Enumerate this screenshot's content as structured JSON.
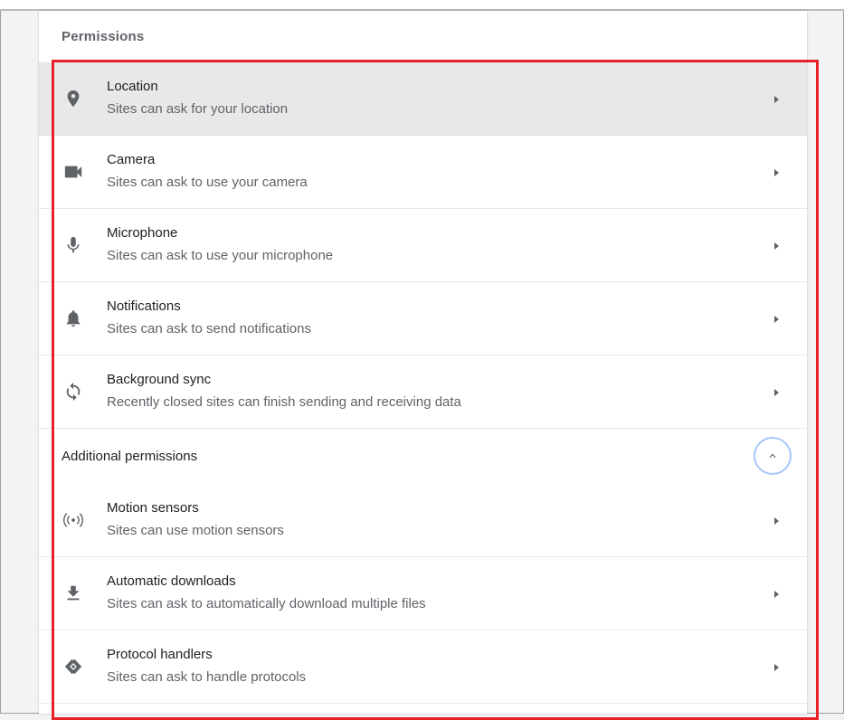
{
  "section": {
    "title": "Permissions"
  },
  "permissions": [
    {
      "icon": "location-pin-icon",
      "title": "Location",
      "sub": "Sites can ask for your location"
    },
    {
      "icon": "camera-icon",
      "title": "Camera",
      "sub": "Sites can ask to use your camera"
    },
    {
      "icon": "microphone-icon",
      "title": "Microphone",
      "sub": "Sites can ask to use your microphone"
    },
    {
      "icon": "bell-icon",
      "title": "Notifications",
      "sub": "Sites can ask to send notifications"
    },
    {
      "icon": "sync-icon",
      "title": "Background sync",
      "sub": "Recently closed sites can finish sending and receiving data"
    }
  ],
  "additional": {
    "label": "Additional permissions",
    "items": [
      {
        "icon": "motion-sensors-icon",
        "title": "Motion sensors",
        "sub": "Sites can use motion sensors"
      },
      {
        "icon": "download-icon",
        "title": "Automatic downloads",
        "sub": "Sites can ask to automatically download multiple files"
      },
      {
        "icon": "protocol-handler-icon",
        "title": "Protocol handlers",
        "sub": "Sites can ask to handle protocols"
      }
    ]
  },
  "colors": {
    "highlight": "#e8202a",
    "hover_row": "#e8e8e8",
    "toggle_ring": "#a8c7fa"
  }
}
